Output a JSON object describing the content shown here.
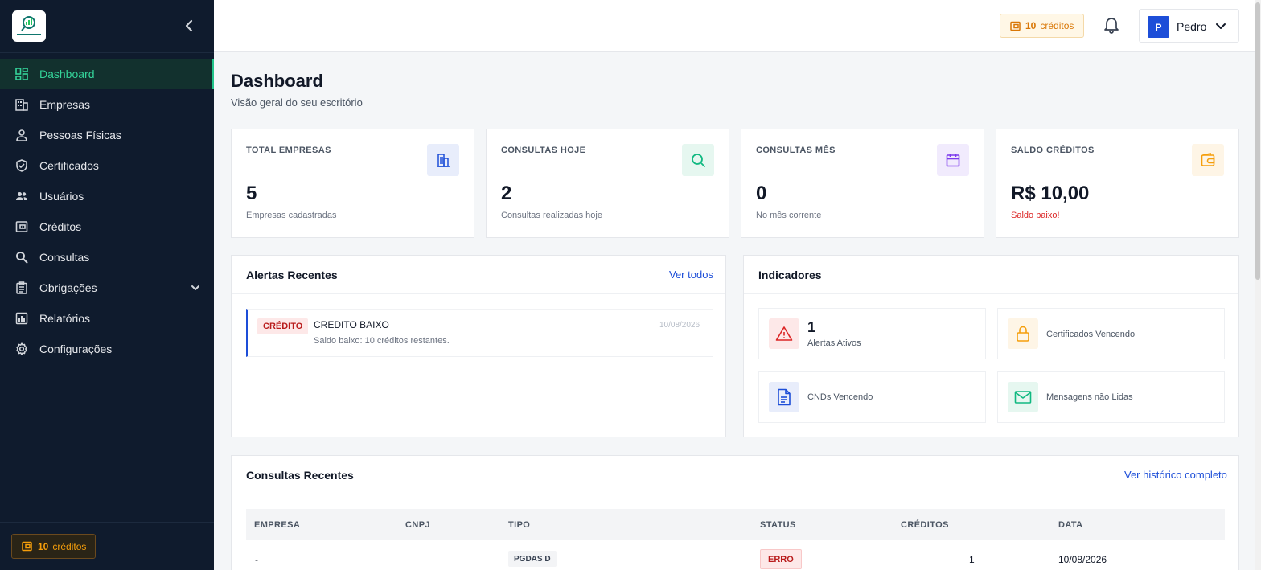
{
  "sidebar": {
    "logo_icon": "app-logo",
    "collapse_icon": "chevron-left-icon",
    "items": [
      {
        "label": "Dashboard",
        "icon": "dashboard-icon",
        "active": true
      },
      {
        "label": "Empresas",
        "icon": "building-icon"
      },
      {
        "label": "Pessoas Físicas",
        "icon": "user-icon"
      },
      {
        "label": "Certificados",
        "icon": "shield-check-icon"
      },
      {
        "label": "Usuários",
        "icon": "users-icon"
      },
      {
        "label": "Créditos",
        "icon": "wallet-icon"
      },
      {
        "label": "Consultas",
        "icon": "search-icon"
      },
      {
        "label": "Obrigações",
        "icon": "clipboard-icon",
        "expandable": true
      },
      {
        "label": "Relatórios",
        "icon": "chart-icon"
      },
      {
        "label": "Configurações",
        "icon": "gear-icon"
      }
    ],
    "credits": {
      "count": "10",
      "label": "créditos"
    }
  },
  "topbar": {
    "credits": {
      "count": "10",
      "label": "créditos"
    },
    "user": {
      "initial": "P",
      "name": "Pedro"
    }
  },
  "page": {
    "title": "Dashboard",
    "subtitle": "Visão geral do seu escritório"
  },
  "stats": [
    {
      "label": "TOTAL EMPRESAS",
      "value": "5",
      "sub": "Empresas cadastradas",
      "icon": "building-icon",
      "color": "#1d4ed8",
      "bg": "#e8edfb"
    },
    {
      "label": "CONSULTAS HOJE",
      "value": "2",
      "sub": "Consultas realizadas hoje",
      "icon": "search-icon",
      "color": "#10b981",
      "bg": "#e6f7f0"
    },
    {
      "label": "CONSULTAS MÊS",
      "value": "0",
      "sub": "No mês corrente",
      "icon": "calendar-icon",
      "color": "#7c3aed",
      "bg": "#f1ebfd"
    },
    {
      "label": "SALDO CRÉDITOS",
      "value": "R$ 10,00",
      "sub": "Saldo baixo!",
      "icon": "wallet-icon",
      "color": "#f59e0b",
      "bg": "#fef5e6"
    }
  ],
  "alerts": {
    "title": "Alertas Recentes",
    "link": "Ver todos",
    "items": [
      {
        "badge": "CRÉDITO",
        "title": "CREDITO BAIXO",
        "desc": "Saldo baixo: 10 créditos restantes.",
        "date": "10/08/2026"
      }
    ]
  },
  "indicators": {
    "title": "Indicadores",
    "items": [
      {
        "value": "1",
        "label": "Alertas Ativos",
        "icon": "warning-icon"
      },
      {
        "value": "",
        "label": "Certificados Vencendo",
        "icon": "lock-icon"
      },
      {
        "value": "",
        "label": "CNDs Vencendo",
        "icon": "document-icon"
      },
      {
        "value": "",
        "label": "Mensagens não Lidas",
        "icon": "mail-icon"
      }
    ]
  },
  "recent": {
    "title": "Consultas Recentes",
    "link": "Ver histórico completo",
    "columns": [
      "EMPRESA",
      "CNPJ",
      "TIPO",
      "STATUS",
      "CRÉDITOS",
      "DATA"
    ],
    "rows": [
      {
        "empresa": "-",
        "cnpj": "",
        "tipo": "PGDAS D",
        "status": "ERRO",
        "creditos": "1",
        "data": "10/08/2026"
      }
    ]
  }
}
